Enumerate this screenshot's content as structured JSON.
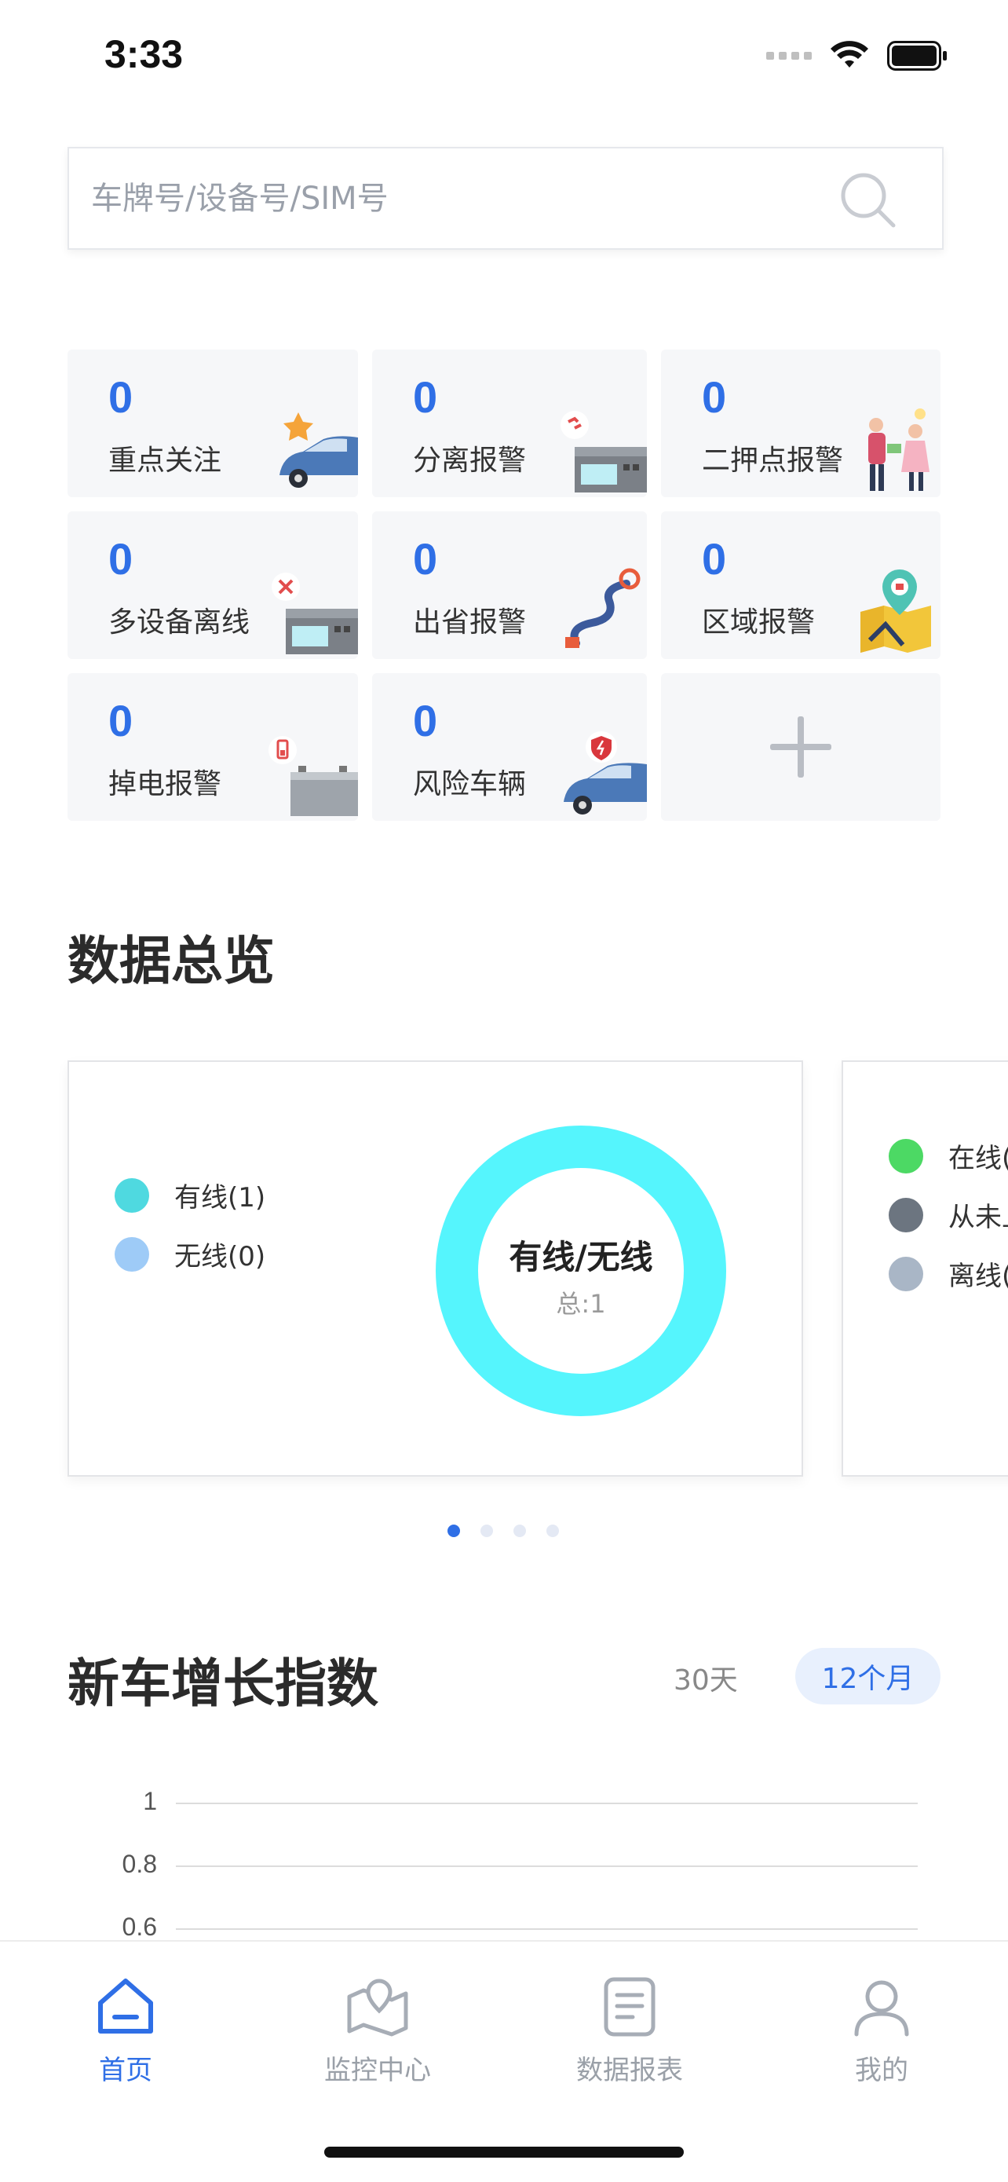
{
  "status": {
    "time": "3:33"
  },
  "search": {
    "placeholder": "车牌号/设备号/SIM号"
  },
  "tiles": [
    {
      "count": "0",
      "label": "重点关注",
      "icon": "car-star-icon"
    },
    {
      "count": "0",
      "label": "分离报警",
      "icon": "device-broken-link-icon"
    },
    {
      "count": "0",
      "label": "二押点报警",
      "icon": "people-exchange-icon"
    },
    {
      "count": "0",
      "label": "多设备离线",
      "icon": "device-offline-icon"
    },
    {
      "count": "0",
      "label": "出省报警",
      "icon": "route-pin-icon"
    },
    {
      "count": "0",
      "label": "区域报警",
      "icon": "map-alarm-icon"
    },
    {
      "count": "0",
      "label": "掉电报警",
      "icon": "battery-alarm-icon"
    },
    {
      "count": "0",
      "label": "风险车辆",
      "icon": "car-shield-icon"
    }
  ],
  "overview": {
    "title": "数据总览",
    "card1": {
      "legend": [
        {
          "label": "有线(1)",
          "color": "#4fd9e0"
        },
        {
          "label": "无线(0)",
          "color": "#9ecbf7"
        }
      ],
      "donut_title": "有线/无线",
      "donut_total": "总:1",
      "donut_color": "#55f5fd"
    },
    "card2": {
      "legend": [
        {
          "label": "在线(",
          "color": "#4cd964"
        },
        {
          "label": "从未上",
          "color": "#6c7580"
        },
        {
          "label": "离线(",
          "color": "#a9b6c6"
        }
      ]
    },
    "pager": {
      "count": 4,
      "active": 0
    }
  },
  "growth": {
    "title": "新车增长指数",
    "range_30": "30天",
    "range_12": "12个月",
    "y_ticks": [
      "1",
      "0.8",
      "0.6"
    ]
  },
  "chart_data": {
    "type": "line",
    "title": "新车增长指数",
    "y_ticks": [
      1,
      0.8,
      0.6
    ],
    "grid": true
  },
  "tabbar": {
    "items": [
      {
        "label": "首页",
        "icon": "home-icon",
        "active": true
      },
      {
        "label": "监控中心",
        "icon": "map-pin-icon",
        "active": false
      },
      {
        "label": "数据报表",
        "icon": "report-icon",
        "active": false
      },
      {
        "label": "我的",
        "icon": "user-icon",
        "active": false
      }
    ]
  },
  "colors": {
    "accent": "#2f6fe6",
    "tile_bg": "#f6f7f9"
  }
}
